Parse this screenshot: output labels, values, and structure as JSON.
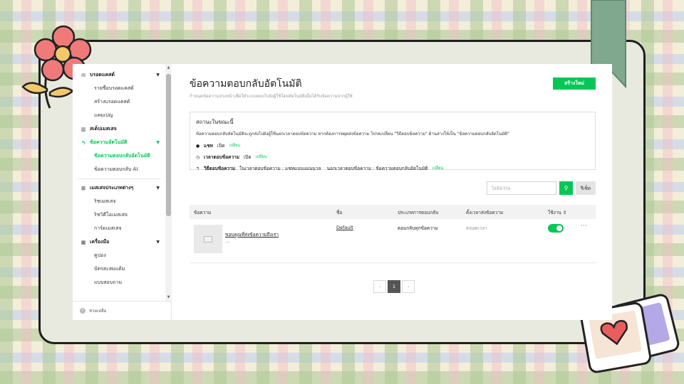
{
  "sidebar": {
    "sections": [
      {
        "icon": "broadcast-icon",
        "label": "บรอดแคสต์",
        "items": [
          "รายชื่อบรอดแคสต์",
          "สร้างบรอดแคสต์",
          "แคมเปญ"
        ]
      },
      {
        "icon": "chart-icon",
        "label": "สเต็ปเมสเสจ",
        "items": []
      },
      {
        "icon": "auto-reply-icon",
        "label": "ข้อความอัตโนมัติ",
        "items": [
          "ข้อความตอบกลับอัตโนมัติ",
          "ข้อความตอบกลับ AI"
        ]
      },
      {
        "icon": "message-types-icon",
        "label": "เมสเสจประเภทต่างๆ",
        "items": [
          "ริชเมสเสจ",
          "ริชวิดีโอเมสเสจ",
          "การ์ดเมสเสจ"
        ]
      },
      {
        "icon": "tools-icon",
        "label": "เครื่องมือ",
        "items": [
          "คูปอง",
          "บัตรสะสมแต้ม",
          "แบบสอบถาม"
        ]
      }
    ],
    "footer": "ช่วยเหลือ"
  },
  "page": {
    "title": "ข้อความตอบกลับอัตโนมัติ",
    "subtitle": "กำหนดข้อความล่วงหน้าเพื่อให้ระบบตอบไปยังผู้ใช้โดยอัตโนมัติเมื่อได้รับข้อความจากผู้ใช้",
    "create_label": "สร้างใหม่"
  },
  "status": {
    "heading": "สถานะในขณะนี้",
    "description": "ข้อความตอบกลับอัตโนมัติจะถูกส่งไปยังผู้ใช้นอกเวลาตอบข้อความ หากต้องการหยุดส่งข้อความ โปรดเปลี่ยน \"วิธีตอบข้อความ\" ด้านล่างให้เป็น \"ข้อความตอบกลับอัตโนมัติ\"",
    "chat_label": "แชท",
    "chat_value": "เปิด",
    "hours_label": "เวลาตอบข้อความ",
    "hours_value": "เปิด",
    "method_label": "วิธีตอบข้อความ",
    "method_value": "ในเวลาตอบข้อความ : แชทแบบแมนนวล    นอกเวลาตอบข้อความ : ข้อความตอบกลับอัตโนมัติ",
    "change_label": "เปลี่ยน"
  },
  "search": {
    "placeholder": "ใส่คีย์เวิร์ด",
    "reset_label": "รีเซ็ต"
  },
  "table": {
    "headers": [
      "ข้อความ",
      "ชื่อ",
      "ประเภทการตอบกลับ",
      "ตั้งเวลาส่งข้อความ",
      "ใช้งาน ⇕"
    ],
    "rows": [
      {
        "message": "ขอบคุณที่ส่งข้อความถึงเรา",
        "message_more": "...",
        "name": "Default",
        "type": "ตอบกลับทุกข้อความ",
        "timing": "ตลอดเวลา",
        "enabled": true
      }
    ]
  },
  "pagination": {
    "current": "1",
    "prev": "‹",
    "next": "›"
  },
  "colors": {
    "accent": "#06c755"
  }
}
